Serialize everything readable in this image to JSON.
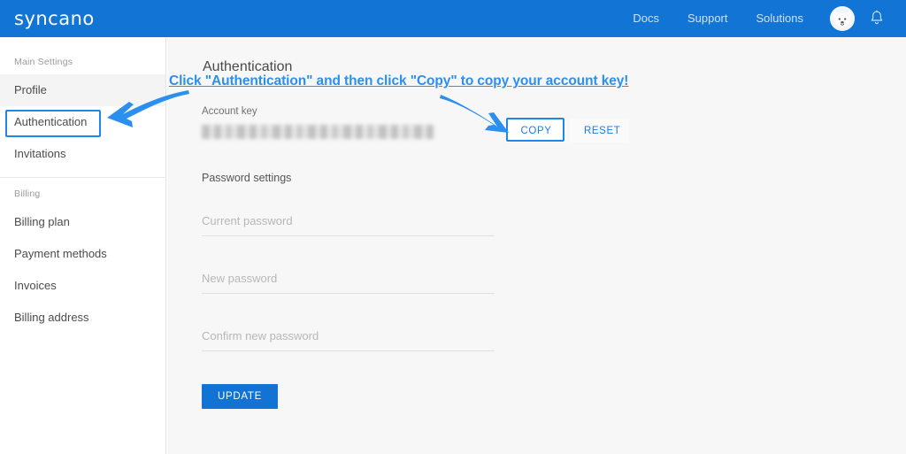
{
  "brand": {
    "logo_text": "syncano",
    "header_color": "#1275d5",
    "accent_color": "#1273d4",
    "annotation_color": "#2b8fee"
  },
  "header": {
    "nav": [
      {
        "label": "Docs",
        "name": "docs"
      },
      {
        "label": "Support",
        "name": "support"
      },
      {
        "label": "Solutions",
        "name": "solutions"
      }
    ],
    "avatar_icon": "user-avatar-dog-icon",
    "notifications_icon": "bell-icon"
  },
  "sidebar": {
    "sections": [
      {
        "title": "Main Settings",
        "items": [
          {
            "label": "Profile",
            "active": true
          },
          {
            "label": "Authentication",
            "active": false
          },
          {
            "label": "Invitations",
            "active": false
          }
        ]
      },
      {
        "title": "Billing",
        "items": [
          {
            "label": "Billing plan",
            "active": false
          },
          {
            "label": "Payment methods",
            "active": false
          },
          {
            "label": "Invoices",
            "active": false
          },
          {
            "label": "Billing address",
            "active": false
          }
        ]
      }
    ]
  },
  "main": {
    "page_title": "Authentication",
    "account_key": {
      "label": "Account key",
      "value": "",
      "masked": true,
      "copy_label": "COPY",
      "reset_label": "RESET"
    },
    "password_settings": {
      "heading": "Password settings",
      "fields": [
        {
          "name": "current-password",
          "placeholder": "Current password",
          "value": ""
        },
        {
          "name": "new-password",
          "placeholder": "New password",
          "value": ""
        },
        {
          "name": "confirm-new-password",
          "placeholder": "Confirm new password",
          "value": ""
        }
      ],
      "submit_label": "UPDATE"
    }
  },
  "annotations": {
    "instruction_text": "Click \"Authentication\" and then click \"Copy\" to copy your account key!",
    "highlight_boxes": [
      "authentication-sidebar-item",
      "copy-button"
    ],
    "arrows": [
      "arrow-to-authentication",
      "arrow-to-copy"
    ]
  }
}
